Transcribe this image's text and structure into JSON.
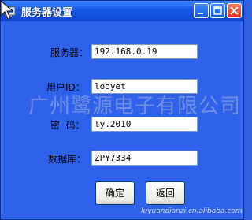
{
  "window": {
    "title": "服务器设置",
    "title_icon": "settings-icon"
  },
  "titlebar_buttons": {
    "minimize": "minimize-icon",
    "maximize": "maximize-icon",
    "close": "close-icon"
  },
  "form": {
    "server_label": "服务器：",
    "server_value": "192.168.0.19",
    "user_label": "用户ID：",
    "user_value": "looyet",
    "password_label": "密  码：",
    "password_value": "ly.2010",
    "database_label": "数据库：",
    "database_value": "ZPY7334"
  },
  "buttons": {
    "ok_label": "确定",
    "back_label": "返回"
  },
  "watermark": {
    "text": "广州鹭源电子有限公司",
    "url": "luyuandianzi.cn.alibaba.com"
  },
  "colors": {
    "window_bg": "#2f62ea",
    "titlebar": "#1a5ae8",
    "close_button": "#d7331b"
  }
}
